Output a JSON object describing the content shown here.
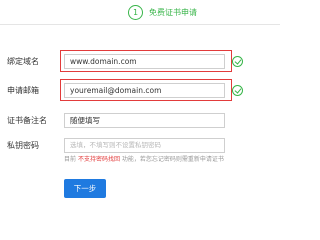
{
  "step": {
    "number": "1",
    "label": "免费证书申请"
  },
  "form": {
    "domain": {
      "label": "绑定域名",
      "value": "www.domain.com"
    },
    "email": {
      "label": "申请邮箱",
      "value": "youremail@domain.com"
    },
    "remark": {
      "label": "证书备注名",
      "value": "随便填写"
    },
    "private_key_password": {
      "label": "私钥密码",
      "placeholder": "选填，不填写则不设置私钥密码"
    }
  },
  "note": {
    "prefix": "目前",
    "warning": "不支持密码找回",
    "suffix": "功能，若您忘记密码则需重新申请证书"
  },
  "buttons": {
    "next": "下一步"
  },
  "colors": {
    "accent_green": "#39b54a",
    "highlight_red": "#e23b3b",
    "button_blue": "#1f7ae0"
  }
}
